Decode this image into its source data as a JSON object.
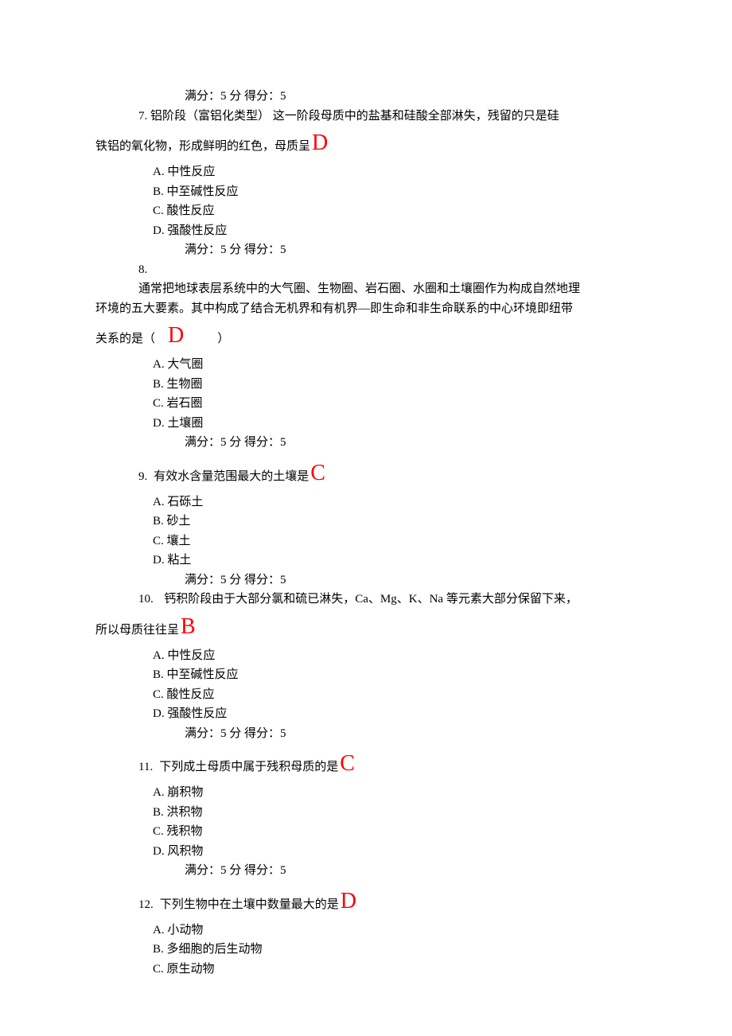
{
  "score_text": "满分：5   分   得分：5",
  "q7": {
    "num": "7.",
    "line1": "铝阶段（富铝化类型） 这一阶段母质中的盐基和硅酸全部淋失，残留的只是硅",
    "line2_pre": "铁铝的氧化物，形成鲜明的红色，母质呈",
    "answer": "D",
    "opts": {
      "a": "A. 中性反应",
      "b": "B. 中至碱性反应",
      "c": "C. 酸性反应",
      "d": "D. 强酸性反应"
    }
  },
  "q8": {
    "num": "8.",
    "line1": "通常把地球表层系统中的大气圈、生物圈、岩石圈、水圈和土壤圈作为构成自然地理",
    "line2": "环境的五大要素。其中构成了结合无机界和有机界—即生命和非生命联系的中心环境即纽带",
    "line3_pre": "关系的是（",
    "line3_post": "）",
    "answer": "D",
    "opts": {
      "a": "A. 大气圈",
      "b": "B. 生物圈",
      "c": "C. 岩石圈",
      "d": "D. 土壤圈"
    }
  },
  "q9": {
    "num": "9.",
    "text": "有效水含量范围最大的土壤是",
    "answer": "C",
    "opts": {
      "a": "A. 石砾土",
      "b": "B. 砂土",
      "c": "C. 壤土",
      "d": "D. 粘土"
    }
  },
  "q10": {
    "num": "10.",
    "line1": "钙积阶段由于大部分氯和硫已淋失，Ca、Mg、K、Na 等元素大部分保留下来，",
    "line2_pre": "所以母质往往呈",
    "answer": "B",
    "opts": {
      "a": "A. 中性反应",
      "b": "B. 中至碱性反应",
      "c": "C. 酸性反应",
      "d": "D. 强酸性反应"
    }
  },
  "q11": {
    "num": "11.",
    "text": "下列成土母质中属于残积母质的是",
    "answer": "C",
    "opts": {
      "a": "A. 崩积物",
      "b": "B. 洪积物",
      "c": "C. 残积物",
      "d": "D. 风积物"
    }
  },
  "q12": {
    "num": "12.",
    "text": "下列生物中在土壤中数量最大的是",
    "answer": "D",
    "opts": {
      "a": "A. 小动物",
      "b": "B. 多细胞的后生动物",
      "c": "C. 原生动物"
    }
  }
}
